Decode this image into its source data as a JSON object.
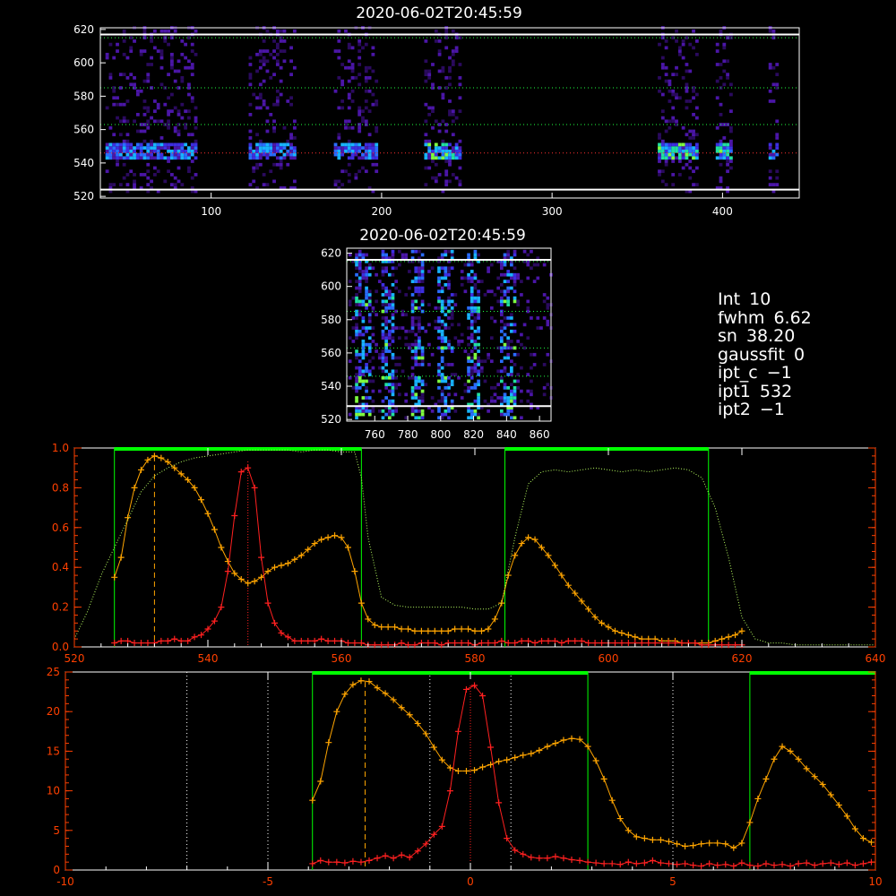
{
  "panel_title": "2020-06-02T20:45:59",
  "info": [
    {
      "label": "Int",
      "value": "10"
    },
    {
      "label": "fwhm",
      "value": "6.62"
    },
    {
      "label": "sn",
      "value": "38.20"
    },
    {
      "label": "gaussfit",
      "value": "0"
    },
    {
      "label": "ipt_c",
      "value": "−1"
    },
    {
      "label": "ipt1",
      "value": "532"
    },
    {
      "label": "ipt2",
      "value": "−1"
    }
  ],
  "colors": {
    "orange": "#ffa500",
    "red": "#ff2020",
    "green": "#00ff00",
    "white": "#ffffff",
    "axis_red": "#ff4000"
  },
  "chart_data": [
    {
      "type": "heatmap",
      "title": "2020-06-02T20:45:59",
      "xlim": [
        35,
        445
      ],
      "ylim": [
        519,
        621
      ],
      "x_ticks": [
        100,
        200,
        300,
        400
      ],
      "y_ticks": [
        520,
        540,
        560,
        580,
        600,
        620
      ],
      "hlines_white": [
        524,
        617
      ],
      "hlines_green": [
        546,
        563,
        585,
        615
      ],
      "hline_red": 546,
      "bright_rows_y": [
        541,
        551
      ],
      "columns_with_signal": [
        [
          38,
          90
        ],
        [
          122,
          148
        ],
        [
          172,
          196
        ],
        [
          225,
          245
        ],
        [
          362,
          384
        ],
        [
          396,
          405
        ],
        [
          427,
          431
        ]
      ]
    },
    {
      "type": "heatmap",
      "title": "2020-06-02T20:45:59",
      "xlim": [
        743,
        867
      ],
      "ylim": [
        519,
        623
      ],
      "x_ticks": [
        760,
        780,
        800,
        820,
        840,
        860
      ],
      "y_ticks": [
        520,
        540,
        560,
        580,
        600,
        620
      ],
      "hlines_white": [
        528,
        616
      ],
      "hlines_green": [
        546,
        563,
        585,
        615
      ],
      "bright_columns_x": [
        752,
        767,
        785,
        802,
        819,
        840
      ]
    },
    {
      "type": "line",
      "xlim": [
        520,
        640
      ],
      "ylim": [
        0,
        1.0
      ],
      "x_ticks": [
        520,
        540,
        560,
        580,
        600,
        620,
        640
      ],
      "y_ticks": [
        0.0,
        0.2,
        0.4,
        0.6,
        0.8,
        1.0
      ],
      "y_tick_labels": [
        "0.0",
        "0.2",
        "0.4",
        "0.6",
        "0.8",
        "1.0"
      ],
      "vlines_green": [
        526,
        563,
        584.5,
        615
      ],
      "green_bars": [
        [
          526,
          563
        ],
        [
          584.5,
          615
        ]
      ],
      "vline_orange_dashed": 532,
      "vline_red_dotted": 546,
      "series": [
        {
          "color": "orange",
          "x": [
            526,
            527,
            528,
            529,
            530,
            531,
            532,
            533,
            534,
            535,
            536,
            537,
            538,
            539,
            540,
            541,
            542,
            543,
            544,
            545,
            546,
            547,
            548,
            549,
            550,
            551,
            552,
            553,
            554,
            555,
            556,
            557,
            558,
            559,
            560,
            561,
            562,
            563,
            564,
            565,
            566,
            567,
            568,
            569,
            570,
            571,
            572,
            573,
            574,
            575,
            576,
            577,
            578,
            579,
            580,
            581,
            582,
            583,
            584,
            585,
            586,
            587,
            588,
            589,
            590,
            591,
            592,
            593,
            594,
            595,
            596,
            597,
            598,
            599,
            600,
            601,
            602,
            603,
            604,
            605,
            606,
            607,
            608,
            609,
            610,
            611,
            612,
            613,
            614,
            615,
            616,
            617,
            618,
            619,
            620
          ],
          "y": [
            0.35,
            0.45,
            0.65,
            0.8,
            0.89,
            0.94,
            0.96,
            0.95,
            0.93,
            0.9,
            0.87,
            0.84,
            0.8,
            0.74,
            0.67,
            0.59,
            0.5,
            0.43,
            0.37,
            0.34,
            0.32,
            0.33,
            0.35,
            0.38,
            0.4,
            0.41,
            0.42,
            0.44,
            0.46,
            0.49,
            0.52,
            0.54,
            0.55,
            0.56,
            0.55,
            0.5,
            0.38,
            0.22,
            0.14,
            0.11,
            0.1,
            0.1,
            0.1,
            0.09,
            0.09,
            0.08,
            0.08,
            0.08,
            0.08,
            0.08,
            0.08,
            0.09,
            0.09,
            0.09,
            0.08,
            0.08,
            0.09,
            0.14,
            0.22,
            0.36,
            0.46,
            0.52,
            0.55,
            0.54,
            0.5,
            0.46,
            0.41,
            0.36,
            0.31,
            0.27,
            0.23,
            0.19,
            0.15,
            0.12,
            0.1,
            0.08,
            0.07,
            0.06,
            0.05,
            0.04,
            0.04,
            0.04,
            0.03,
            0.03,
            0.03,
            0.02,
            0.02,
            0.02,
            0.02,
            0.02,
            0.03,
            0.04,
            0.05,
            0.06,
            0.08
          ]
        },
        {
          "color": "red",
          "x": [
            526,
            527,
            528,
            529,
            530,
            531,
            532,
            533,
            534,
            535,
            536,
            537,
            538,
            539,
            540,
            541,
            542,
            543,
            544,
            545,
            546,
            547,
            548,
            549,
            550,
            551,
            552,
            553,
            554,
            555,
            556,
            557,
            558,
            559,
            560,
            561,
            562,
            563,
            564,
            565,
            566,
            567,
            568,
            569,
            570,
            571,
            572,
            573,
            574,
            575,
            576,
            577,
            578,
            579,
            580,
            581,
            582,
            583,
            584,
            585,
            586,
            587,
            588,
            589,
            590,
            591,
            592,
            593,
            594,
            595,
            596,
            597,
            598,
            599,
            600,
            601,
            602,
            603,
            604,
            605,
            606,
            607,
            608,
            609,
            610,
            611,
            612,
            613,
            614,
            615,
            616,
            617,
            618,
            619,
            620
          ],
          "y": [
            0.02,
            0.03,
            0.03,
            0.02,
            0.02,
            0.02,
            0.02,
            0.03,
            0.03,
            0.04,
            0.03,
            0.03,
            0.05,
            0.06,
            0.09,
            0.13,
            0.2,
            0.38,
            0.66,
            0.88,
            0.9,
            0.8,
            0.45,
            0.22,
            0.12,
            0.07,
            0.05,
            0.03,
            0.03,
            0.03,
            0.03,
            0.04,
            0.03,
            0.03,
            0.03,
            0.02,
            0.02,
            0.02,
            0.01,
            0.01,
            0.01,
            0.01,
            0.01,
            0.02,
            0.01,
            0.01,
            0.02,
            0.02,
            0.02,
            0.01,
            0.02,
            0.02,
            0.02,
            0.02,
            0.01,
            0.02,
            0.02,
            0.02,
            0.03,
            0.02,
            0.02,
            0.03,
            0.03,
            0.02,
            0.03,
            0.03,
            0.03,
            0.02,
            0.03,
            0.03,
            0.03,
            0.02,
            0.02,
            0.02,
            0.02,
            0.02,
            0.02,
            0.02,
            0.02,
            0.02,
            0.02,
            0.02,
            0.02,
            0.02,
            0.02,
            0.02,
            0.02,
            0.02,
            0.01,
            0.01,
            0.01,
            0.01,
            0.01,
            0.01,
            0.01
          ]
        },
        {
          "color": "green_dotted",
          "x": [
            520,
            522,
            524,
            526,
            528,
            530,
            532,
            534,
            536,
            538,
            540,
            542,
            544,
            546,
            548,
            550,
            552,
            554,
            556,
            558,
            560,
            562,
            563,
            564,
            566,
            568,
            570,
            572,
            574,
            576,
            578,
            580,
            582,
            584,
            586,
            588,
            590,
            592,
            594,
            596,
            598,
            600,
            602,
            604,
            606,
            608,
            610,
            612,
            614,
            616,
            618,
            620,
            622,
            624,
            626,
            628,
            630,
            632,
            634,
            636,
            638,
            640
          ],
          "y": [
            0.04,
            0.18,
            0.36,
            0.5,
            0.64,
            0.78,
            0.86,
            0.9,
            0.93,
            0.95,
            0.96,
            0.97,
            0.98,
            0.99,
            0.99,
            0.99,
            0.99,
            0.98,
            0.99,
            0.99,
            0.98,
            0.98,
            0.85,
            0.55,
            0.25,
            0.21,
            0.2,
            0.2,
            0.2,
            0.2,
            0.2,
            0.19,
            0.19,
            0.22,
            0.55,
            0.82,
            0.88,
            0.89,
            0.88,
            0.89,
            0.9,
            0.89,
            0.88,
            0.89,
            0.88,
            0.89,
            0.9,
            0.89,
            0.85,
            0.7,
            0.45,
            0.15,
            0.04,
            0.02,
            0.02,
            0.01,
            0.01,
            0.01,
            0.01,
            0.01,
            0.01,
            0.01
          ]
        }
      ]
    },
    {
      "type": "line",
      "xlim": [
        -10,
        10
      ],
      "ylim": [
        0,
        25
      ],
      "x_ticks": [
        -10,
        -5,
        0,
        5,
        10
      ],
      "y_ticks": [
        0,
        5,
        10,
        15,
        20,
        25
      ],
      "y_tick_labels": [
        "0",
        "5",
        "10",
        "15",
        "20",
        "25"
      ],
      "vlines_green": [
        -3.9,
        2.9,
        6.9
      ],
      "green_bars": [
        [
          -3.9,
          2.9
        ],
        [
          6.9,
          10
        ]
      ],
      "vlines_white_dotted": [
        -7,
        -5,
        -1,
        1,
        5
      ],
      "vline_orange_dashed": -2.6,
      "vline_red_dotted": 0,
      "series": [
        {
          "color": "orange",
          "x": [
            -3.9,
            -3.7,
            -3.5,
            -3.3,
            -3.1,
            -2.9,
            -2.7,
            -2.5,
            -2.3,
            -2.1,
            -1.9,
            -1.7,
            -1.5,
            -1.3,
            -1.1,
            -0.9,
            -0.7,
            -0.5,
            -0.3,
            -0.1,
            0.1,
            0.3,
            0.5,
            0.7,
            0.9,
            1.1,
            1.3,
            1.5,
            1.7,
            1.9,
            2.1,
            2.3,
            2.5,
            2.7,
            2.9,
            3.1,
            3.3,
            3.5,
            3.7,
            3.9,
            4.1,
            4.3,
            4.5,
            4.7,
            4.9,
            5.1,
            5.3,
            5.5,
            5.7,
            5.9,
            6.1,
            6.3,
            6.5,
            6.7,
            6.9,
            7.1,
            7.3,
            7.5,
            7.7,
            7.9,
            8.1,
            8.3,
            8.5,
            8.7,
            8.9,
            9.1,
            9.3,
            9.5,
            9.7,
            9.9
          ],
          "y": [
            8.8,
            11.2,
            16.1,
            20.0,
            22.2,
            23.4,
            23.9,
            23.8,
            23.0,
            22.3,
            21.5,
            20.5,
            19.6,
            18.5,
            17.2,
            15.5,
            13.9,
            12.9,
            12.5,
            12.5,
            12.6,
            13.0,
            13.3,
            13.7,
            13.9,
            14.2,
            14.5,
            14.7,
            15.1,
            15.6,
            16.0,
            16.4,
            16.6,
            16.5,
            15.6,
            13.8,
            11.5,
            8.8,
            6.5,
            5.0,
            4.2,
            4.0,
            3.8,
            3.8,
            3.6,
            3.3,
            3.0,
            3.1,
            3.3,
            3.4,
            3.4,
            3.3,
            2.8,
            3.4,
            6.0,
            9.0,
            11.5,
            14.0,
            15.6,
            15.0,
            14.0,
            12.8,
            11.8,
            10.8,
            9.5,
            8.2,
            6.8,
            5.2,
            4.0,
            3.5
          ]
        },
        {
          "color": "red",
          "x": [
            -3.9,
            -3.7,
            -3.5,
            -3.3,
            -3.1,
            -2.9,
            -2.7,
            -2.5,
            -2.3,
            -2.1,
            -1.9,
            -1.7,
            -1.5,
            -1.3,
            -1.1,
            -0.9,
            -0.7,
            -0.5,
            -0.3,
            -0.1,
            0.1,
            0.3,
            0.5,
            0.7,
            0.9,
            1.1,
            1.3,
            1.5,
            1.7,
            1.9,
            2.1,
            2.3,
            2.5,
            2.7,
            2.9,
            3.1,
            3.3,
            3.5,
            3.7,
            3.9,
            4.1,
            4.3,
            4.5,
            4.7,
            4.9,
            5.1,
            5.3,
            5.5,
            5.7,
            5.9,
            6.1,
            6.3,
            6.5,
            6.7,
            6.9,
            7.1,
            7.3,
            7.5,
            7.7,
            7.9,
            8.1,
            8.3,
            8.5,
            8.7,
            8.9,
            9.1,
            9.3,
            9.5,
            9.7,
            9.9
          ],
          "y": [
            0.8,
            1.2,
            1.0,
            1.0,
            0.9,
            1.1,
            1.0,
            1.2,
            1.5,
            1.8,
            1.5,
            1.9,
            1.6,
            2.4,
            3.3,
            4.5,
            5.5,
            10.0,
            17.5,
            22.8,
            23.3,
            22.0,
            15.5,
            8.5,
            4.0,
            2.5,
            2.0,
            1.6,
            1.5,
            1.5,
            1.7,
            1.5,
            1.3,
            1.2,
            1.0,
            0.9,
            0.8,
            0.8,
            0.7,
            1.0,
            0.8,
            0.9,
            1.2,
            0.9,
            0.8,
            0.7,
            0.8,
            0.6,
            0.5,
            0.8,
            0.6,
            0.7,
            0.5,
            0.9,
            0.6,
            0.5,
            0.8,
            0.6,
            0.7,
            0.5,
            0.8,
            0.9,
            0.6,
            0.8,
            0.9,
            0.7,
            0.9,
            0.6,
            0.8,
            1.0
          ]
        }
      ]
    }
  ]
}
